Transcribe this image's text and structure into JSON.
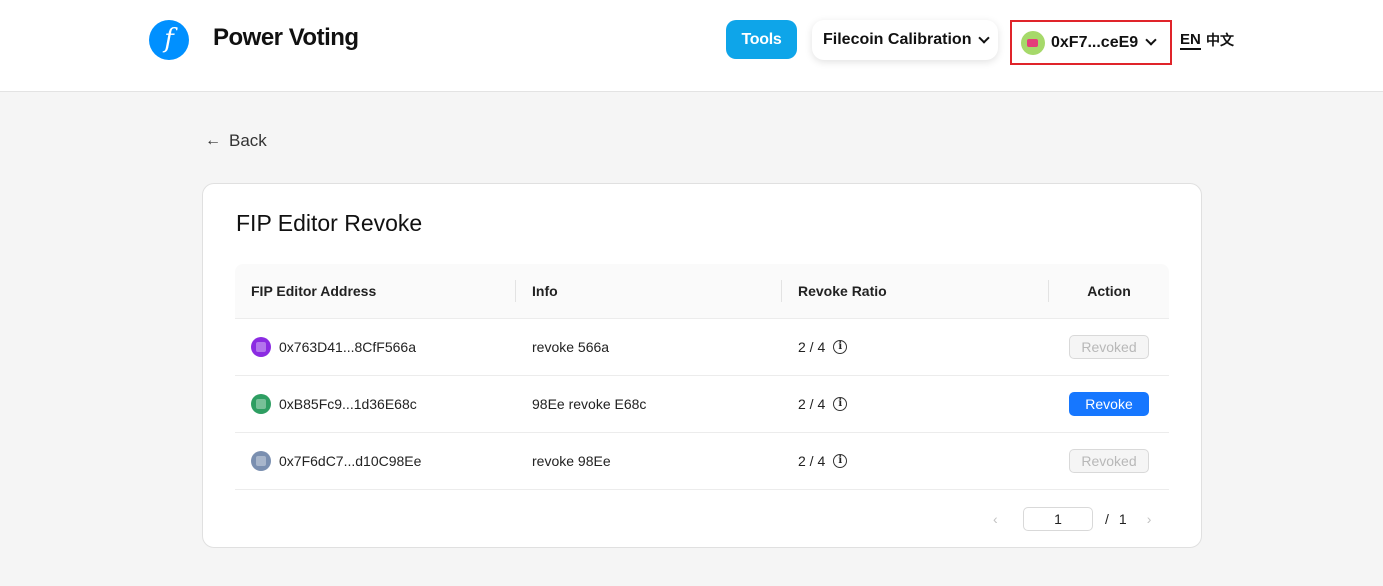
{
  "header": {
    "logo_glyph": "f",
    "brand": "Power Voting",
    "tools_label": "Tools",
    "network_label": "Filecoin Calibration",
    "account_label": "0xF7...ceE9",
    "lang_en": "EN",
    "lang_zh": "中文"
  },
  "back_label": "Back",
  "card": {
    "title": "FIP Editor Revoke",
    "columns": [
      "FIP Editor Address",
      "Info",
      "Revoke Ratio",
      "Action"
    ],
    "rows": [
      {
        "address": "0x763D41...8CfF566a",
        "info": "revoke 566a",
        "ratio": "2 / 4",
        "action": "Revoked",
        "action_enabled": false,
        "avatar_color": "#8b2be2"
      },
      {
        "address": "0xB85Fc9...1d36E68c",
        "info": "98Ee revoke E68c",
        "ratio": "2 / 4",
        "action": "Revoke",
        "action_enabled": true,
        "avatar_color": "#2e9e62"
      },
      {
        "address": "0x7F6dC7...d10C98Ee",
        "info": "revoke 98Ee",
        "ratio": "2 / 4",
        "action": "Revoked",
        "action_enabled": false,
        "avatar_color": "#7a8fb0"
      }
    ]
  },
  "pagination": {
    "current": "1",
    "slash": "/",
    "total": "1",
    "prev_icon": "‹",
    "next_icon": "›"
  },
  "colors": {
    "accent": "#1677ff",
    "tools": "#0ea5e9",
    "highlight_border": "#e0242a"
  }
}
